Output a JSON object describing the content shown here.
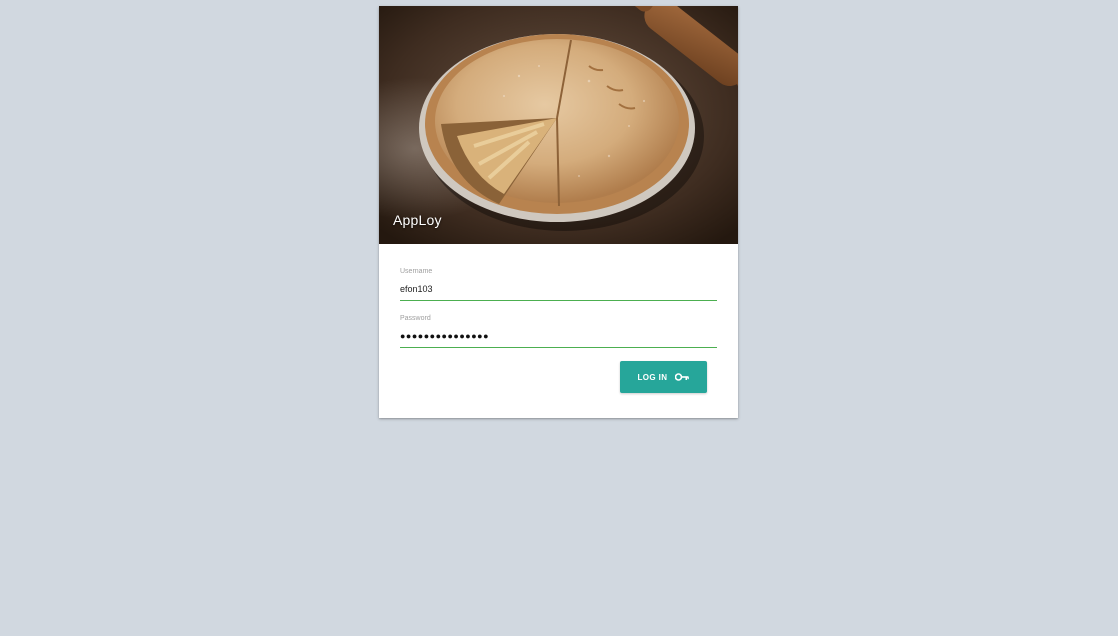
{
  "app": {
    "title": "AppLoy"
  },
  "hero": {
    "image_subject": "apple pie with slice removed on wooden table with rolling pin"
  },
  "form": {
    "username": {
      "label": "Username",
      "value": "efon103"
    },
    "password": {
      "label": "Password",
      "value": "●●●●●●●●●●●●●●●"
    },
    "login_button": {
      "label": "LOG IN",
      "icon": "key-icon"
    }
  },
  "colors": {
    "page_background": "#d1d8e0",
    "card_background": "#ffffff",
    "field_underline": "#4caf50",
    "button_background": "#26a69a",
    "button_text": "#ffffff"
  }
}
